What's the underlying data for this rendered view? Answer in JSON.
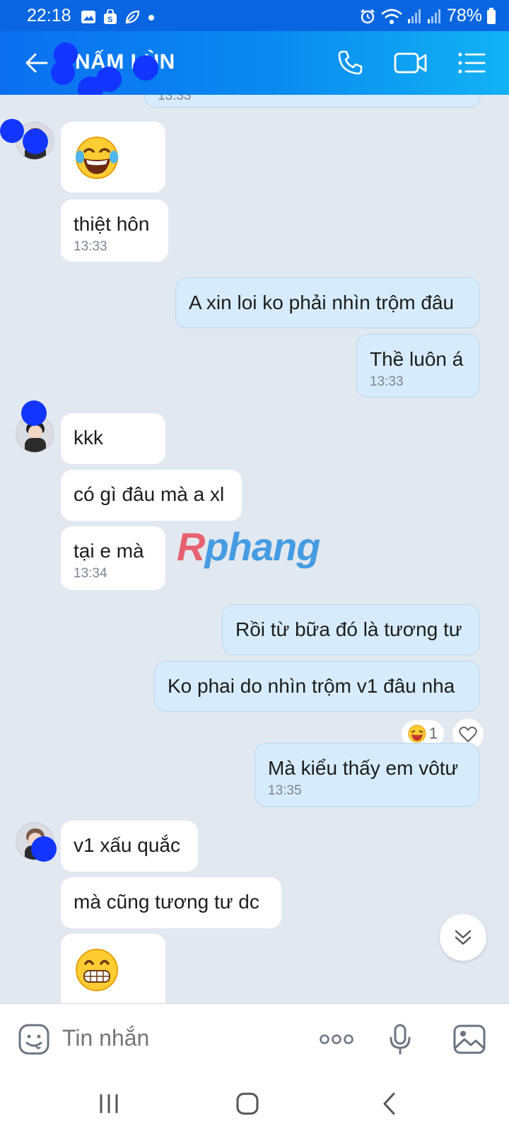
{
  "status_bar": {
    "time": "22:18",
    "battery": "78%",
    "icons": [
      "image-icon",
      "shop-bag-icon",
      "leaf-icon",
      "dot-icon",
      "alarm-icon",
      "wifi-icon",
      "signal-icon",
      "signal-icon",
      "battery-icon"
    ]
  },
  "header": {
    "contact_name": "NẤM LÙN",
    "icons": [
      "back-arrow-icon",
      "phone-icon",
      "video-call-icon",
      "list-menu-icon"
    ]
  },
  "messages": [
    {
      "side": "out",
      "text": "",
      "time": "13:33",
      "partial": true
    },
    {
      "side": "in",
      "emoji": "tears-of-joy-emoji",
      "avatar": true
    },
    {
      "side": "in",
      "text": "thiệt hôn",
      "time": "13:33"
    },
    {
      "side": "out",
      "text": "A xin loi ko phải nhìn trộm đâu"
    },
    {
      "side": "out",
      "text": "Thề luôn á",
      "time": "13:33"
    },
    {
      "side": "in",
      "text": "kkk",
      "avatar": true
    },
    {
      "side": "in",
      "text": "có gì đâu mà a xl"
    },
    {
      "side": "in",
      "text": "tại e mà",
      "time": "13:34"
    },
    {
      "side": "out",
      "text": "Rồi từ bữa đó là tương tư"
    },
    {
      "side": "out",
      "text": "Ko phai do nhìn trộm v1 đâu nha",
      "reaction": {
        "emoji": "laughing-emoji",
        "count": "1"
      }
    },
    {
      "side": "out",
      "text": "Mà kiểu thấy em vôtư",
      "time": "13:35"
    },
    {
      "side": "in",
      "text": "v1 xấu quắc",
      "avatar": true
    },
    {
      "side": "in",
      "text": "mà cũng tương tư dc"
    },
    {
      "side": "in",
      "emoji": "grinning-emoji"
    }
  ],
  "watermark": {
    "first": "R",
    "rest": "phang"
  },
  "input_bar": {
    "placeholder": "Tin nhắn"
  },
  "colors": {
    "header_start": "#0b6ff0",
    "header_end": "#12b2f4",
    "chat_bg": "#e2e8f0",
    "outgoing_bubble": "#d6ecfc",
    "incoming_bubble": "#ffffff",
    "redaction_blob": "#1236ff"
  }
}
